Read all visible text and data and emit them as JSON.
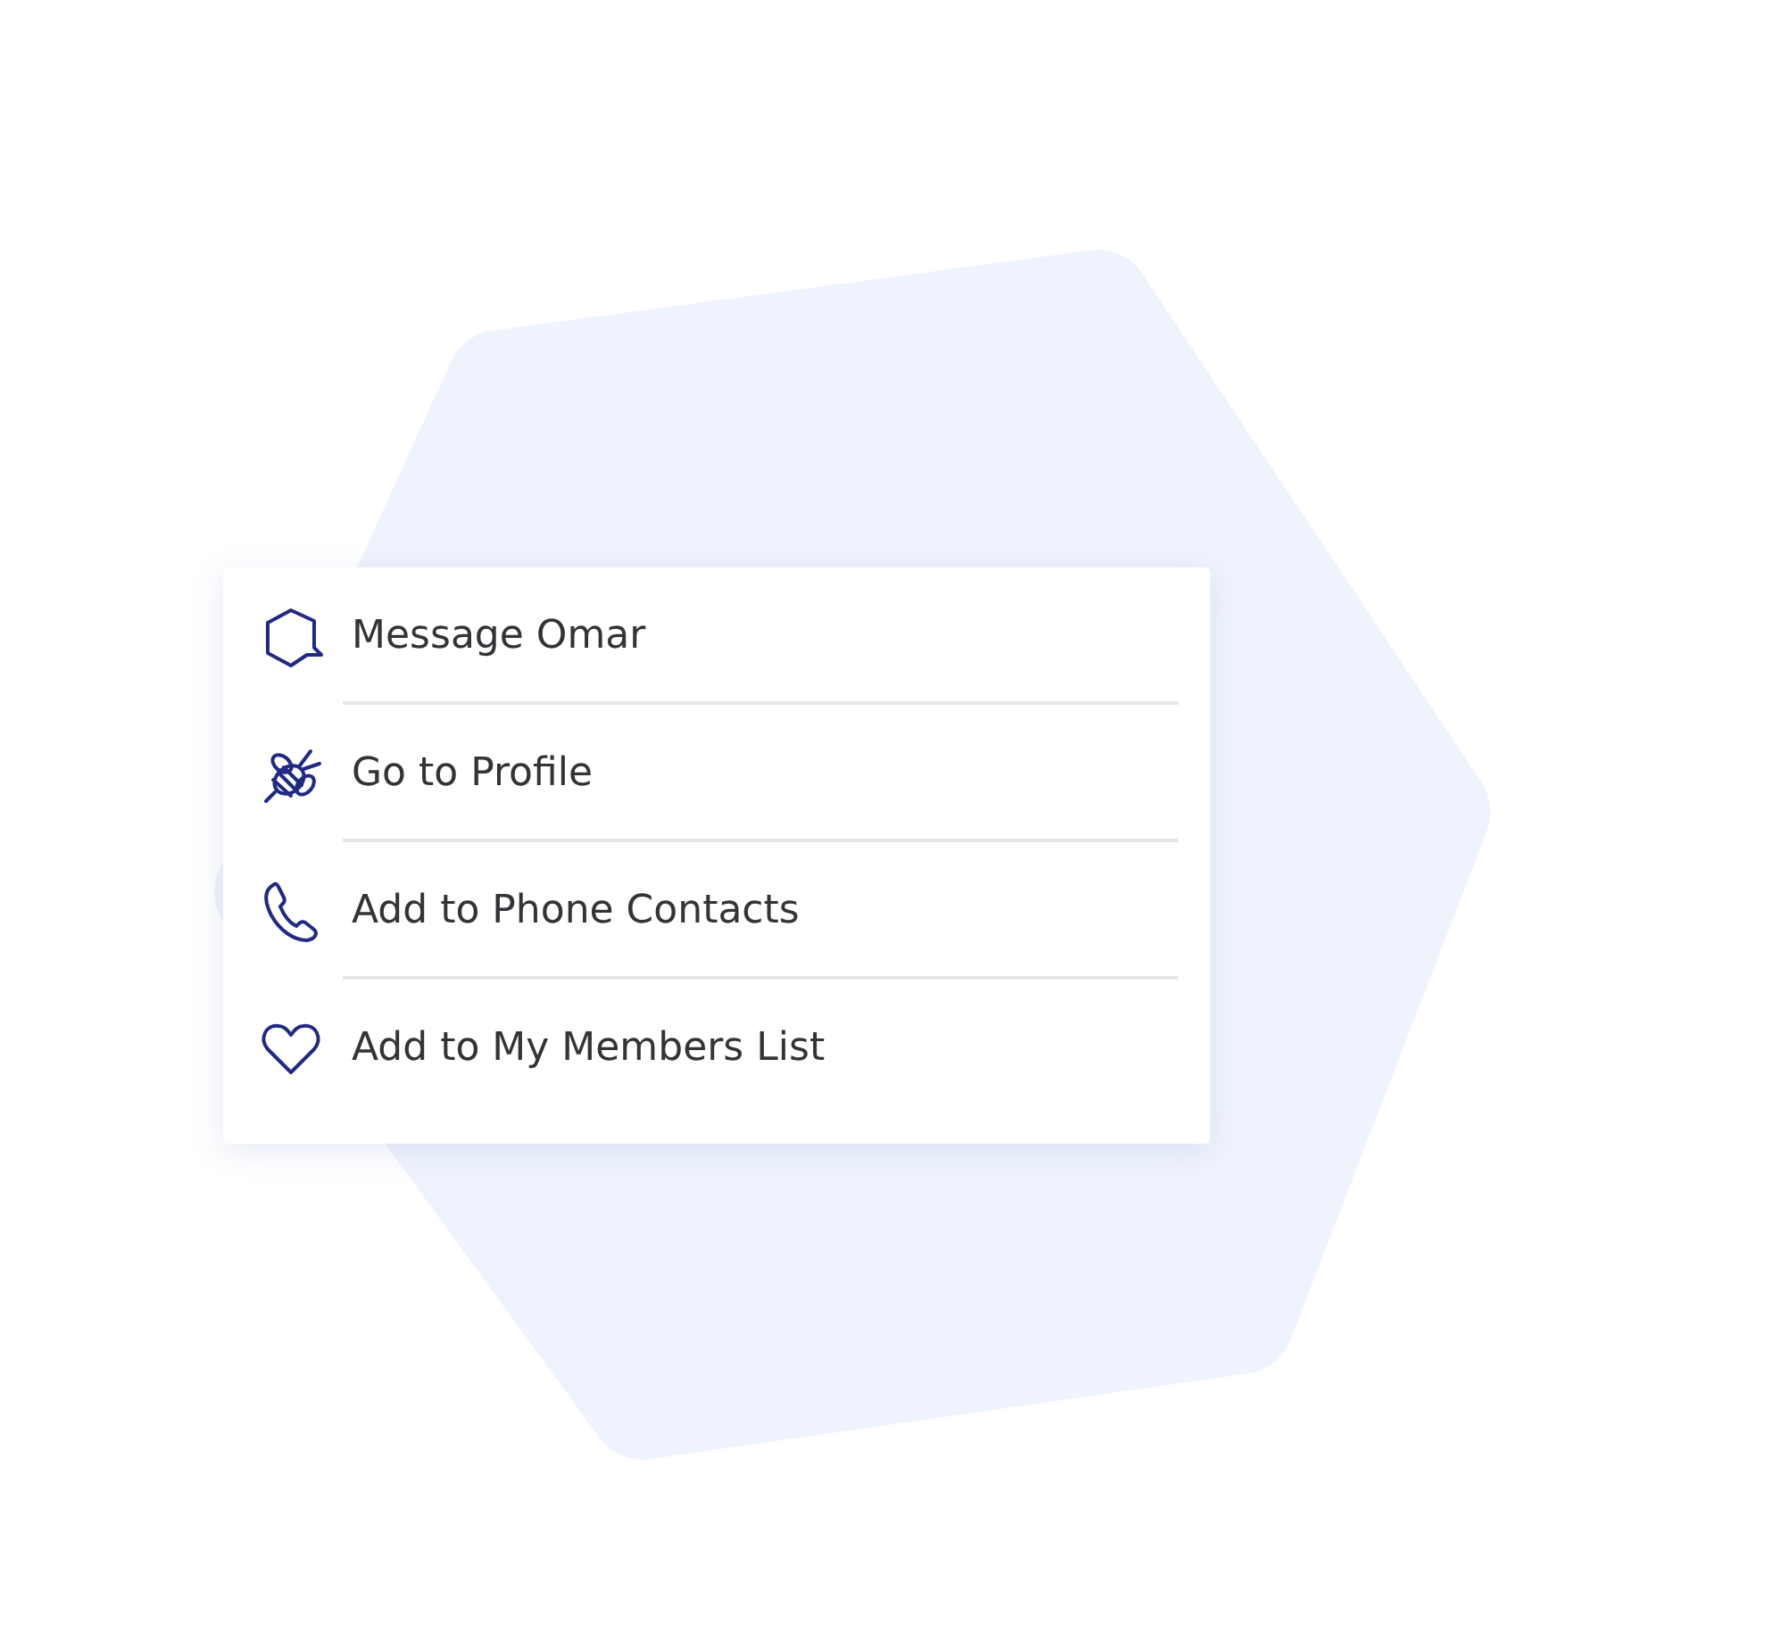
{
  "menu": {
    "items": [
      {
        "kind": "message",
        "label": "Message Omar"
      },
      {
        "kind": "profile",
        "label": "Go to Profile"
      },
      {
        "kind": "phone",
        "label": "Add to Phone Contacts"
      },
      {
        "kind": "favorite",
        "label": "Add to My Members List"
      }
    ]
  }
}
